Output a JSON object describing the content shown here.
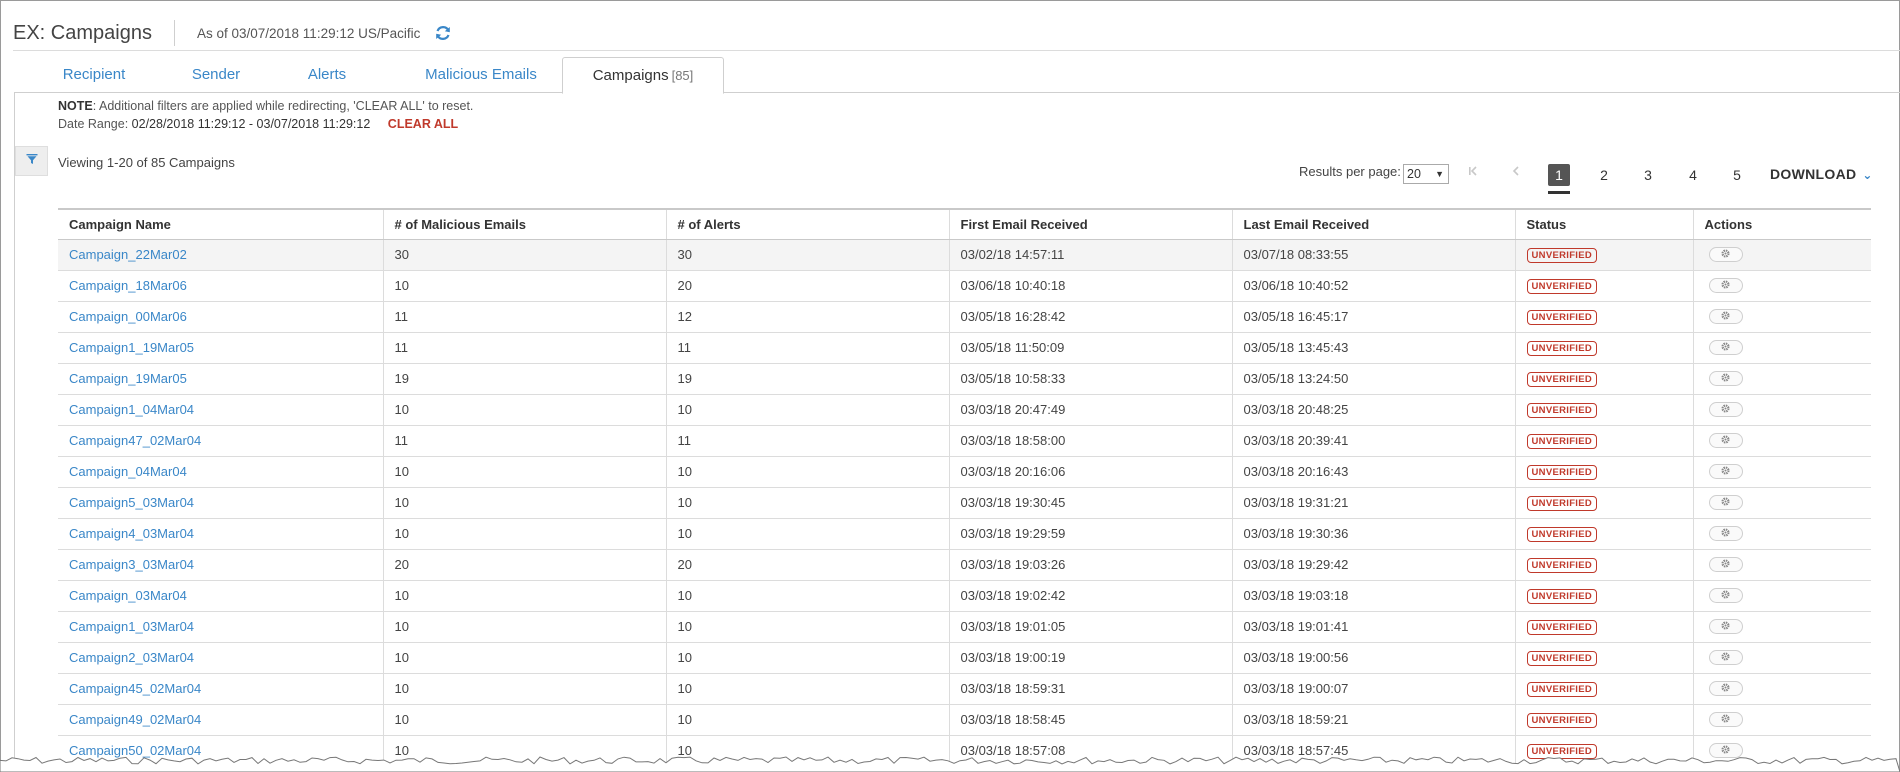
{
  "header": {
    "title": "EX: Campaigns",
    "as_of": "As of 03/07/2018 11:29:12 US/Pacific"
  },
  "tabs": [
    {
      "label": "Recipient",
      "count": ""
    },
    {
      "label": "Sender",
      "count": ""
    },
    {
      "label": "Alerts",
      "count": ""
    },
    {
      "label": "Malicious Emails",
      "count": ""
    },
    {
      "label": "Campaigns",
      "count": "[85]"
    }
  ],
  "note": {
    "label": "NOTE",
    "text": ": Additional filters are applied while redirecting, 'CLEAR ALL' to reset."
  },
  "date_range": {
    "label": "Date Range:",
    "value": "02/28/2018 11:29:12 - 03/07/2018 11:29:12",
    "clear_label": "CLEAR ALL"
  },
  "viewing": "Viewing 1-20 of 85 Campaigns",
  "pager": {
    "results_label": "Results per page:",
    "per_page": "20",
    "pages": [
      "1",
      "2",
      "3",
      "4",
      "5"
    ],
    "current": "1",
    "download_label": "DOWNLOAD"
  },
  "table": {
    "columns": [
      "Campaign Name",
      "# of Malicious Emails",
      "# of Alerts",
      "First Email Received",
      "Last Email Received",
      "Status",
      "Actions"
    ],
    "status_label": "UNVERIFIED",
    "rows": [
      [
        "Campaign_22Mar02",
        "30",
        "30",
        "03/02/18 14:57:11",
        "03/07/18 08:33:55"
      ],
      [
        "Campaign_18Mar06",
        "10",
        "20",
        "03/06/18 10:40:18",
        "03/06/18 10:40:52"
      ],
      [
        "Campaign_00Mar06",
        "11",
        "12",
        "03/05/18 16:28:42",
        "03/05/18 16:45:17"
      ],
      [
        "Campaign1_19Mar05",
        "11",
        "11",
        "03/05/18 11:50:09",
        "03/05/18 13:45:43"
      ],
      [
        "Campaign_19Mar05",
        "19",
        "19",
        "03/05/18 10:58:33",
        "03/05/18 13:24:50"
      ],
      [
        "Campaign1_04Mar04",
        "10",
        "10",
        "03/03/18 20:47:49",
        "03/03/18 20:48:25"
      ],
      [
        "Campaign47_02Mar04",
        "11",
        "11",
        "03/03/18 18:58:00",
        "03/03/18 20:39:41"
      ],
      [
        "Campaign_04Mar04",
        "10",
        "10",
        "03/03/18 20:16:06",
        "03/03/18 20:16:43"
      ],
      [
        "Campaign5_03Mar04",
        "10",
        "10",
        "03/03/18 19:30:45",
        "03/03/18 19:31:21"
      ],
      [
        "Campaign4_03Mar04",
        "10",
        "10",
        "03/03/18 19:29:59",
        "03/03/18 19:30:36"
      ],
      [
        "Campaign3_03Mar04",
        "20",
        "20",
        "03/03/18 19:03:26",
        "03/03/18 19:29:42"
      ],
      [
        "Campaign_03Mar04",
        "10",
        "10",
        "03/03/18 19:02:42",
        "03/03/18 19:03:18"
      ],
      [
        "Campaign1_03Mar04",
        "10",
        "10",
        "03/03/18 19:01:05",
        "03/03/18 19:01:41"
      ],
      [
        "Campaign2_03Mar04",
        "10",
        "10",
        "03/03/18 19:00:19",
        "03/03/18 19:00:56"
      ],
      [
        "Campaign45_02Mar04",
        "10",
        "10",
        "03/03/18 18:59:31",
        "03/03/18 19:00:07"
      ],
      [
        "Campaign49_02Mar04",
        "10",
        "10",
        "03/03/18 18:58:45",
        "03/03/18 18:59:21"
      ],
      [
        "Campaign50_02Mar04",
        "10",
        "10",
        "03/03/18 18:57:08",
        "03/03/18 18:57:45"
      ]
    ]
  },
  "colors": {
    "link": "#3a87c8",
    "status": "#c0392b",
    "clear_all": "#c0392b"
  },
  "icons": {
    "refresh": "refresh-icon",
    "filter": "filter-icon",
    "first_page": "first-page-icon",
    "prev_page": "prev-page-icon",
    "download": "chevron-down-icon",
    "actions": "gear-icon"
  }
}
